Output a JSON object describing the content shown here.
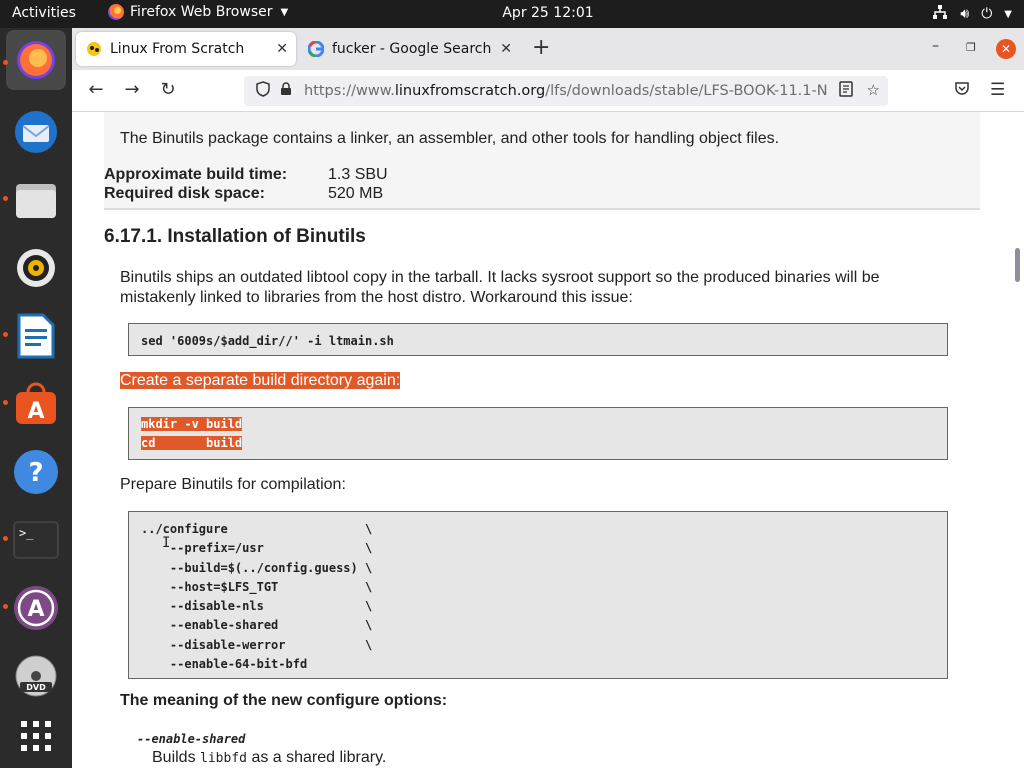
{
  "topbar": {
    "activities": "Activities",
    "app_name": "Firefox Web Browser",
    "clock": "Apr 25  12:01"
  },
  "dock": {
    "items": [
      {
        "name": "Firefox"
      },
      {
        "name": "Thunderbird"
      },
      {
        "name": "Files"
      },
      {
        "name": "Rhythmbox"
      },
      {
        "name": "LibreOffice Writer"
      },
      {
        "name": "Ubuntu Software"
      },
      {
        "name": "Help"
      },
      {
        "name": "Terminal"
      },
      {
        "name": "Software Updater"
      },
      {
        "name": "DVD"
      },
      {
        "name": "Show Applications"
      }
    ]
  },
  "tabs": [
    {
      "title": "Linux From Scratch",
      "active": true
    },
    {
      "title": "fucker - Google Search",
      "active": false
    }
  ],
  "url": {
    "scheme": "https://www.",
    "domain": "linuxfromscratch.org",
    "path": "/lfs/downloads/stable/LFS-BOOK-11.1-N"
  },
  "page": {
    "pkg_description": "The Binutils package contains a linker, an assembler, and other tools for handling object files.",
    "build_time_label": "Approximate build time:",
    "build_time_value": "1.3 SBU",
    "disk_space_label": "Required disk space:",
    "disk_space_value": "520 MB",
    "section_title": "6.17.1. Installation of Binutils",
    "intro_line1": "Binutils ships an outdated libtool copy in the tarball. It lacks sysroot support so the produced binaries will be",
    "intro_line2": "mistakenly linked to libraries from the host distro. Workaround this issue:",
    "code_sed": "sed '6009s/$add_dir//' -i ltmain.sh",
    "build_dir_text": "Create a separate build directory again:",
    "code_mkdir_1": "mkdir -v build",
    "code_mkdir_2": "cd       build",
    "prepare_text": "Prepare Binutils for compilation:",
    "configure_lines": [
      "../configure                   \\",
      "    --prefix=/usr              \\",
      "    --build=$(../config.guess) \\",
      "    --host=$LFS_TGT            \\",
      "    --disable-nls              \\",
      "    --enable-shared            \\",
      "    --disable-werror           \\",
      "    --enable-64-bit-bfd"
    ],
    "meaning_heading": "The meaning of the new configure options:",
    "option_term": "--enable-shared",
    "option_def_pre": "Builds ",
    "option_def_lit": "libbfd",
    "option_def_post": " as a shared library."
  },
  "colors": {
    "highlight": "#e05a29",
    "ubuntu_orange": "#e95420"
  }
}
